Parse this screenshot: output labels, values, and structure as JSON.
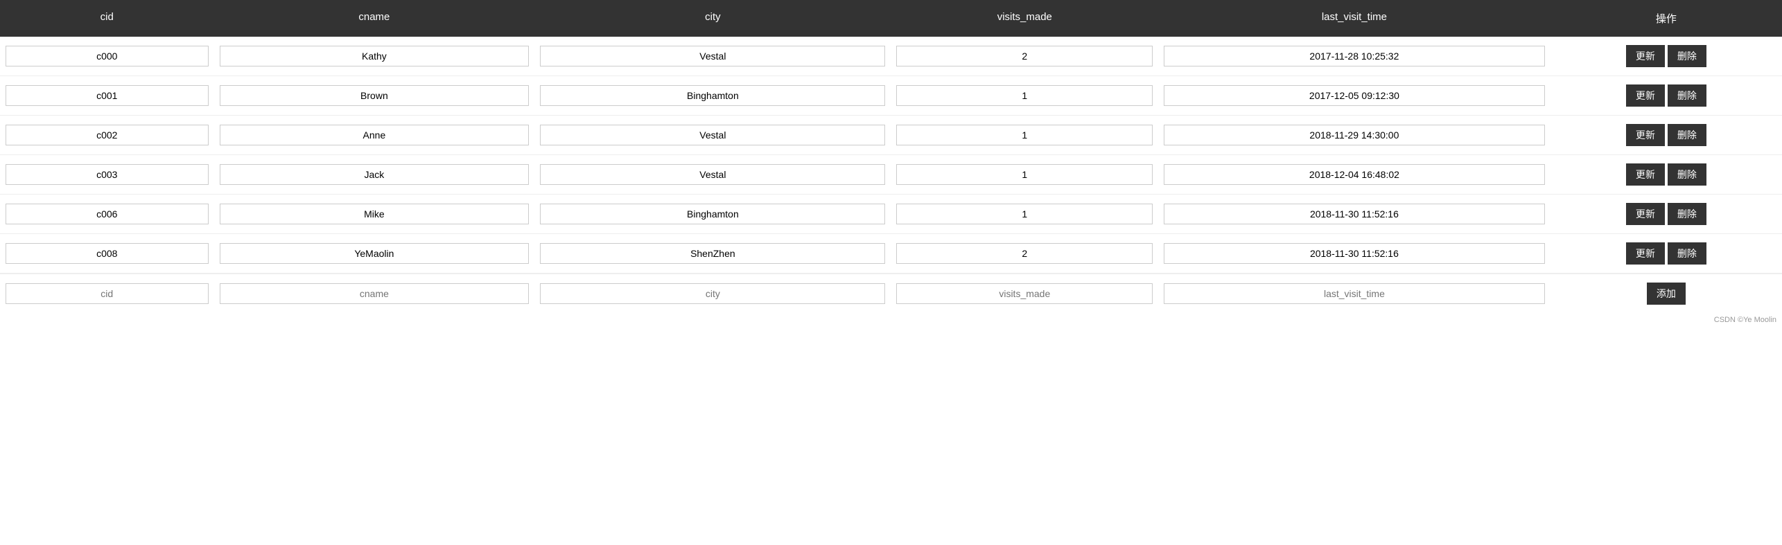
{
  "header": {
    "col_cid": "cid",
    "col_cname": "cname",
    "col_city": "city",
    "col_visits": "visits_made",
    "col_last_visit": "last_visit_time",
    "col_actions": "操作"
  },
  "rows": [
    {
      "cid": "c000",
      "cname": "Kathy",
      "city": "Vestal",
      "visits": "2",
      "last_visit": "2017-11-28 10:25:32"
    },
    {
      "cid": "c001",
      "cname": "Brown",
      "city": "Binghamton",
      "visits": "1",
      "last_visit": "2017-12-05 09:12:30"
    },
    {
      "cid": "c002",
      "cname": "Anne",
      "city": "Vestal",
      "visits": "1",
      "last_visit": "2018-11-29 14:30:00"
    },
    {
      "cid": "c003",
      "cname": "Jack",
      "city": "Vestal",
      "visits": "1",
      "last_visit": "2018-12-04 16:48:02"
    },
    {
      "cid": "c006",
      "cname": "Mike",
      "city": "Binghamton",
      "visits": "1",
      "last_visit": "2018-11-30 11:52:16"
    },
    {
      "cid": "c008",
      "cname": "YeMaolin",
      "city": "ShenZhen",
      "visits": "2",
      "last_visit": "2018-11-30 11:52:16"
    }
  ],
  "add_row": {
    "cid_placeholder": "cid",
    "cname_placeholder": "cname",
    "city_placeholder": "city",
    "visits_placeholder": "visits_made",
    "last_visit_placeholder": "last_visit_time"
  },
  "buttons": {
    "update": "更新",
    "delete": "删除",
    "add": "添加"
  },
  "footer": "CSDN ©Ye Moolin"
}
